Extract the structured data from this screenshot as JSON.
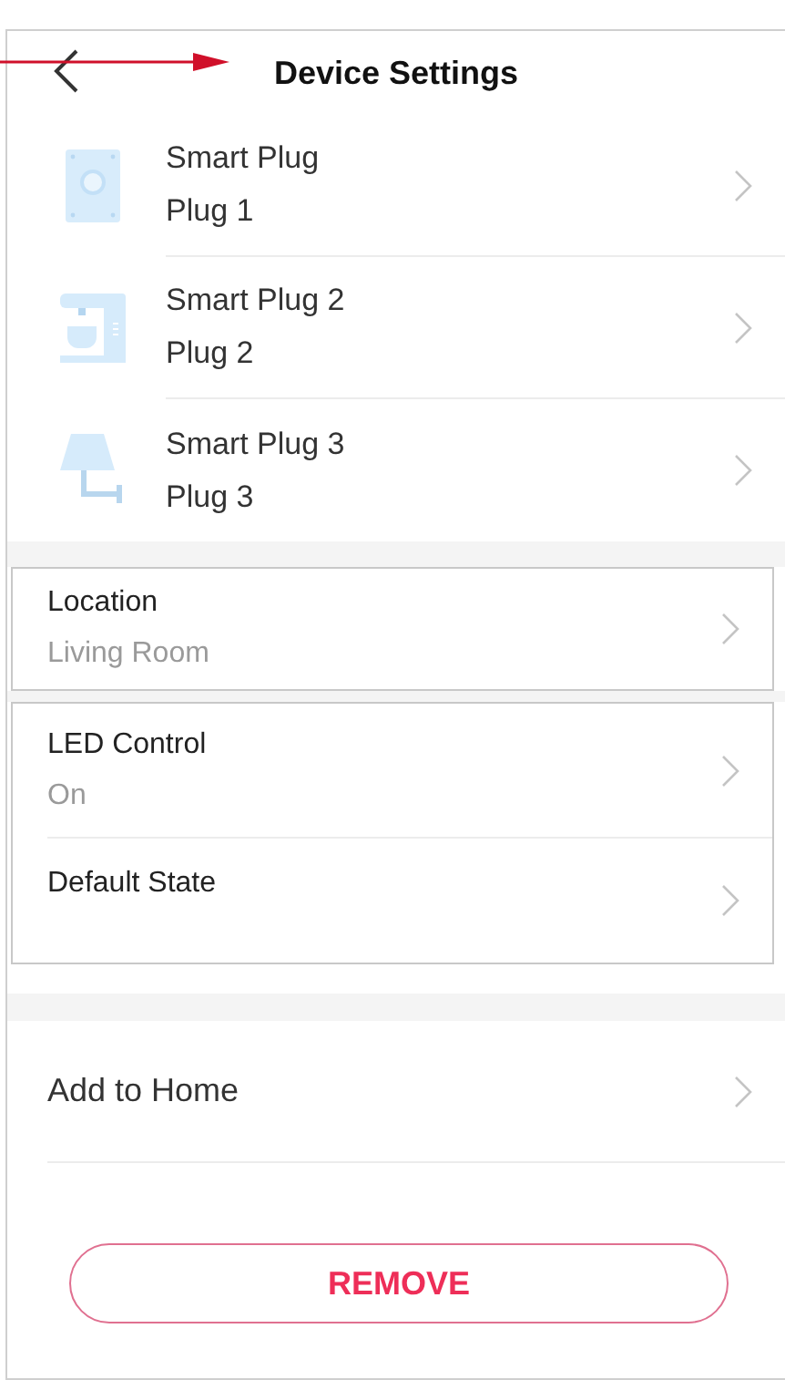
{
  "header": {
    "title": "Device Settings"
  },
  "devices": [
    {
      "name": "Smart Plug",
      "label": "Plug 1",
      "kind": "plug"
    },
    {
      "name": "Smart Plug 2",
      "label": "Plug 2",
      "kind": "coffee"
    },
    {
      "name": "Smart Plug 3",
      "label": "Plug 3",
      "kind": "lamp"
    }
  ],
  "location": {
    "label": "Location",
    "value": "Living Room"
  },
  "led_settings": [
    {
      "label": "LED Control",
      "value": "On"
    },
    {
      "label": "Default State"
    }
  ],
  "actions": [
    {
      "label": "Add to Home"
    }
  ],
  "remove_button": "REMOVE"
}
